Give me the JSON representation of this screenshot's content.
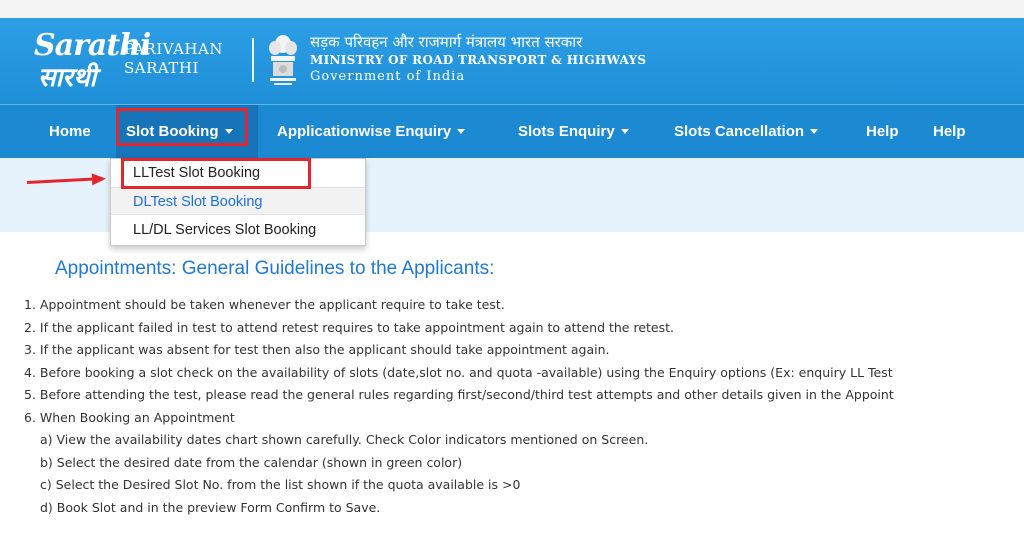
{
  "header": {
    "logo_line1": "Sarathi",
    "logo_line2": "सारथी",
    "brand_line1": "PARIVAHAN",
    "brand_line2": "SARATHI",
    "ministry_hindi": "सड़क परिवहन और राजमार्ग मंत्रालय भारत सरकार",
    "ministry_english": "MINISTRY OF ROAD TRANSPORT & HIGHWAYS",
    "government": "Government of India"
  },
  "nav": {
    "items": [
      {
        "label": "Home"
      },
      {
        "label": "Slot Booking"
      },
      {
        "label": "Applicationwise Enquiry"
      },
      {
        "label": "Slots Enquiry"
      },
      {
        "label": "Slots Cancellation"
      },
      {
        "label": "Help"
      },
      {
        "label": "Help"
      }
    ]
  },
  "dropdown": {
    "items": [
      {
        "label": "LLTest Slot Booking"
      },
      {
        "label": "DLTest Slot Booking"
      },
      {
        "label": "LL/DL Services Slot Booking"
      }
    ]
  },
  "guidelines": {
    "title": "Appointments: General Guidelines to the Applicants:",
    "lines": [
      "1. Appointment should be taken whenever the applicant require to take test.",
      "2. If the applicant failed in test to attend retest requires to take appointment again to attend the retest.",
      "3. If the applicant was absent for test then also the applicant should take appointment again.",
      "4. Before booking a slot check on the availability of slots (date,slot no. and quota -available) using the Enquiry options (Ex: enquiry LL Test",
      "5. Before attending the test, please read the general rules regarding first/second/third test attempts and other details given in the Appoint",
      "6. When Booking an Appointment"
    ],
    "sub_lines": [
      "a) View the availability dates chart shown carefully. Check Color indicators mentioned on Screen.",
      "b) Select the desired date from the calendar (shown in green color)",
      "c) Select the Desired Slot No. from the list shown if the quota available is >0",
      "d) Book Slot and in the preview Form Confirm to Save."
    ]
  },
  "colors": {
    "header_blue": "#1f8fd8",
    "nav_blue": "#1b8ad3",
    "highlight_red": "#e3262b",
    "link_blue": "#1f6fe0"
  }
}
